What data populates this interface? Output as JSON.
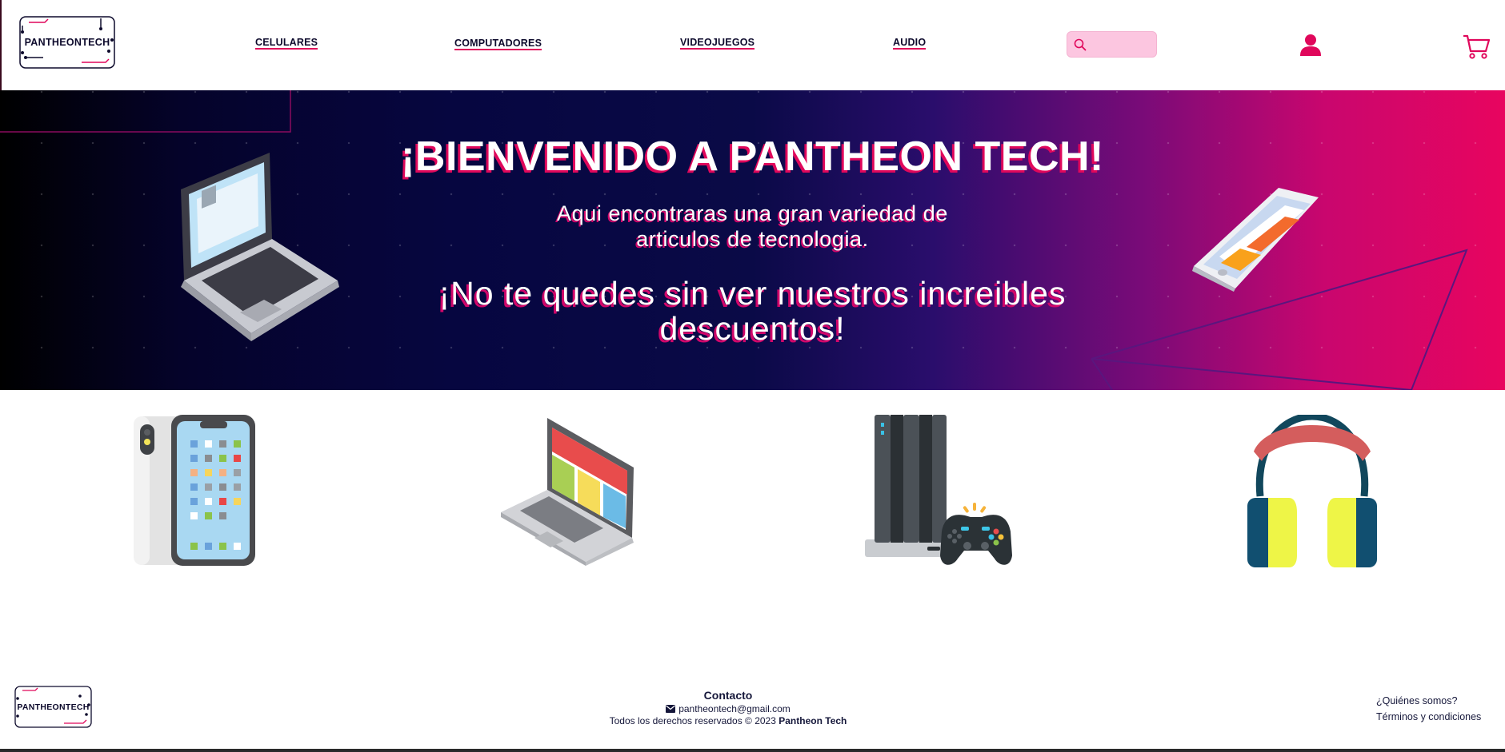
{
  "header": {
    "logo_text": "PANTHEONTECH",
    "nav": [
      {
        "label": "CELULARES"
      },
      {
        "label": "COMPUTADORES"
      },
      {
        "label": "VIDEOJUEGOS"
      },
      {
        "label": "AUDIO"
      }
    ],
    "search_placeholder": "",
    "search_icon": "search-icon",
    "user_icon": "user-icon",
    "cart_icon": "cart-icon"
  },
  "hero": {
    "title": "¡BIENVENIDO A PANTHEON TECH!",
    "subtitle": "Aqui encontraras una gran variedad de\narticulos de tecnologia.",
    "promo": "¡No te quedes sin ver nuestros increibles\ndescuentos!"
  },
  "categories": [
    {
      "name": "celulares",
      "icon": "smartphone-illustration"
    },
    {
      "name": "computadores",
      "icon": "laptop-illustration"
    },
    {
      "name": "videojuegos",
      "icon": "console-illustration"
    },
    {
      "name": "audio",
      "icon": "headphones-illustration"
    }
  ],
  "footer": {
    "logo_text": "PANTHEONTECH",
    "contact_title": "Contacto",
    "email": "pantheontech@gmail.com",
    "copyright_prefix": "Todos los derechos reservados © 2023",
    "copyright_brand": "Pantheon Tech",
    "links": [
      {
        "label": "¿Quiénes somos?"
      },
      {
        "label": "Términos y condiciones"
      }
    ]
  },
  "colors": {
    "accent": "#e0075b",
    "search_bg": "#fcc6e0",
    "dark_text": "#0d0a2c"
  }
}
